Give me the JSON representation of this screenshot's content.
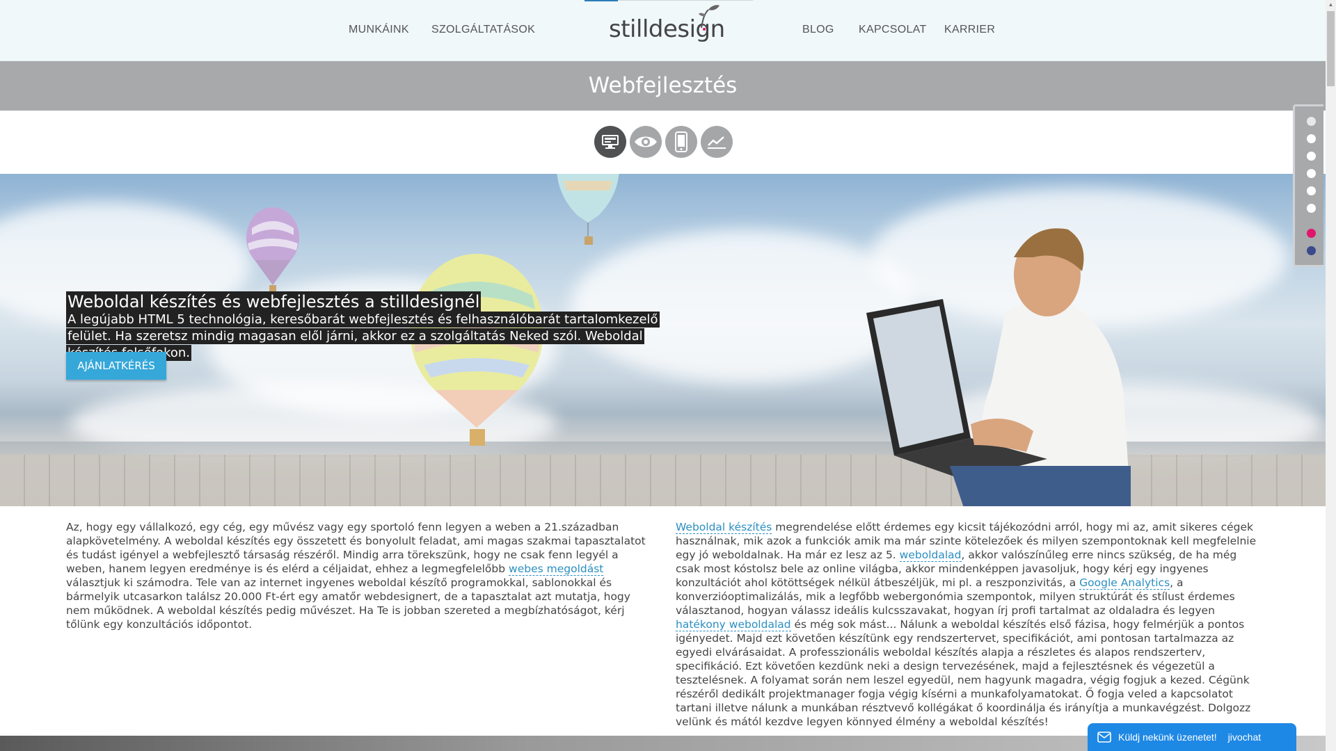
{
  "nav": {
    "left": [
      "MUNKÁINK",
      "SZOLGÁLTATÁSOK"
    ],
    "right": [
      "BLOG",
      "KAPCSOLAT",
      "KARRIER"
    ],
    "logo": "stilldesign"
  },
  "page_title": "Webfejlesztés",
  "service_icons": [
    "desktop-icon",
    "eye-icon",
    "mobile-icon",
    "chart-line-icon"
  ],
  "hero": {
    "title": "Weboldal készítés és webfejlesztés a stilldesignél",
    "text": "A legújabb HTML 5 technológia, keresőbarát webfejlesztés és felhasználóbarát tartalomkezelő felület. Ha szeretsz mindig magasan elől járni, akkor ez a szolgáltatás Neked szól. Weboldal készítés felsőfokon.",
    "cta": "AJÁNLATKÉRÉS"
  },
  "left_column": {
    "p1": "Az, hogy egy vállalkozó, egy cég, egy művész vagy egy sportoló fenn legyen a weben a 21.században alapkövetelmény. A weboldal készítés egy összetett és bonyolult feladat, ami magas szakmai tapasztalatot és tudást igényel a webfejlesztő társaság részéről. Mindig arra törekszünk, hogy ne csak fenn legyél a weben, hanem legyen eredménye is és elérd a céljaidat, ehhez a legmegfelelőbb ",
    "link1": "webes megoldást",
    "p2": " választjuk ki számodra. Tele van az internet ingyenes weboldal készítő programokkal, sablonokkal és bármelyik utcasarkon találsz 20.000 Ft-ért egy amatőr webdesignert, de a tapasztalat azt mutatja, hogy nem működnek. A weboldal készítés pedig művészet. Ha Te is jobban szereted a megbízhatóságot, kérj tőlünk egy konzultációs időpontot."
  },
  "right_column": {
    "link1": "Weboldal készítés",
    "p1": " megrendelése előtt érdemes egy kicsit tájékozódni arról, hogy mi az, amit sikeres cégek használnak, mik azok a funkciók amik ma már szinte kötelezőek és milyen szempontoknak kell megfelelnie egy jó weboldalnak. Ha már ez lesz az 5. ",
    "link2": "weboldalad",
    "p2": ", akkor valószínűleg erre nincs szükség, de ha még csak most kóstolsz bele az online világba, akkor mindenképpen javasoljuk, hogy kérj egy ingyenes konzultációt ahol kötöttségek nélkül átbeszéljük, mi pl. a reszponzivitás, a ",
    "link3": "Google Analytics",
    "p3": ", a konverzióoptimalizálás, mik a legfőbb webergonómia szempontok, milyen struktúrát és stílust érdemes választanod, hogyan válassz ideális kulcsszavakat, hogyan írj profi tartalmat az oldaladra és legyen ",
    "link4": "hatékony weboldalad",
    "p4": " és még sok mást... Nálunk a weboldal készítés első fázisa, hogy felmérjük a pontos igényedet.  Majd ezt követően készítünk egy rendszertervet, specifikációt, ami pontosan tartalmazza az egyedi elvárásaidat. A professzionális weboldal készítés alapja a részletes és alapos rendszerterv, specifikáció. Ezt követően kezdünk neki a design tervezésének, majd a fejlesztésnek és végezetül a tesztelésnek. A folyamat során nem leszel egyedül, nem hagyunk magadra, végig fogjuk a kezed. Cégünk részéről dedikált projektmanager fogja végig kísérni a munkafolyamatokat. Ő fogja veled a kapcsolatot tartani illetve nálunk a munkában résztvevő kollégákat ő koordinálja és irányítja a munkavégzést. Dolgozz velünk és mától kezdve legyen könnyed élmény a weboldal készítés!"
  },
  "chat": {
    "label": "Küldj nekünk üzenetet!",
    "brand": "jivochat"
  },
  "colors": {
    "accent": "#35a7d9",
    "pager_active": "#e0166c",
    "pager_last": "#3a4a8c"
  }
}
